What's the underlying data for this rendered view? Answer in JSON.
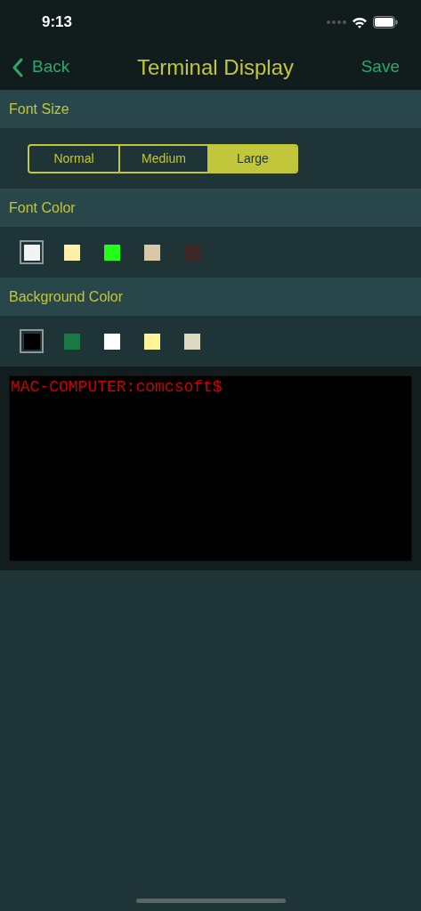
{
  "status_bar": {
    "time": "9:13"
  },
  "nav": {
    "back": "Back",
    "title": "Terminal Display",
    "save": "Save"
  },
  "font_size": {
    "title": "Font Size",
    "options": [
      {
        "label": "Normal",
        "selected": false
      },
      {
        "label": "Medium",
        "selected": false
      },
      {
        "label": "Large",
        "selected": true
      }
    ]
  },
  "font_color": {
    "title": "Font Color",
    "swatches": [
      {
        "color": "#f2f4f3",
        "selected": true
      },
      {
        "color": "#fff0a8",
        "selected": false
      },
      {
        "color": "#22ff1a",
        "selected": false
      },
      {
        "color": "#d8c8a6",
        "selected": false
      },
      {
        "color": "#3f2524",
        "selected": false
      }
    ]
  },
  "background_color": {
    "title": "Background Color",
    "swatches": [
      {
        "color": "#000000",
        "selected": true
      },
      {
        "color": "#177a43",
        "selected": false
      },
      {
        "color": "#ffffff",
        "selected": false
      },
      {
        "color": "#fff49a",
        "selected": false
      },
      {
        "color": "#e0dac2",
        "selected": false
      }
    ]
  },
  "terminal": {
    "prompt": "MAC-COMPUTER:comcsoft$"
  }
}
